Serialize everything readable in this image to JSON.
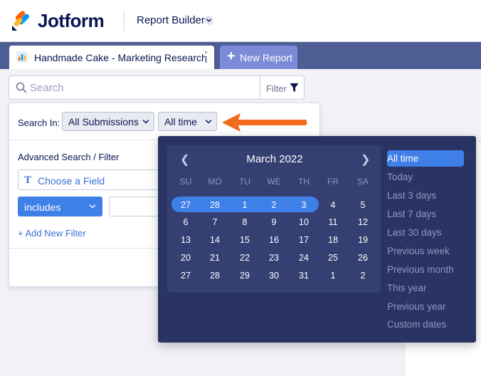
{
  "header": {
    "brand": "Jotform",
    "product": "Report Builder"
  },
  "tabs": {
    "active_title": "Handmade Cake - Marketing Research",
    "new_report": "New Report"
  },
  "search": {
    "placeholder": "Search",
    "filter_label": "Filter"
  },
  "filter_panel": {
    "search_in_label": "Search In:",
    "submissions_select": "All Submissions",
    "time_select": "All time",
    "advanced_label": "Advanced Search / Filter",
    "field_placeholder": "Choose a Field",
    "condition": "includes",
    "add_filter": "+ Add New Filter"
  },
  "calendar": {
    "month": "March 2022",
    "weekdays": [
      "SU",
      "MO",
      "TU",
      "WE",
      "TH",
      "FR",
      "SA"
    ],
    "weeks": [
      [
        "27",
        "28",
        "1",
        "2",
        "3",
        "4",
        "5"
      ],
      [
        "6",
        "7",
        "8",
        "9",
        "10",
        "11",
        "12"
      ],
      [
        "13",
        "14",
        "15",
        "16",
        "17",
        "18",
        "19"
      ],
      [
        "20",
        "21",
        "22",
        "23",
        "24",
        "25",
        "26"
      ],
      [
        "27",
        "28",
        "29",
        "30",
        "31",
        "1",
        "2"
      ]
    ],
    "presets": [
      "All time",
      "Today",
      "Last 3 days",
      "Last 7 days",
      "Last 30 days",
      "Previous week",
      "Previous month",
      "This year",
      "Previous year",
      "Custom dates"
    ],
    "active_preset": "All time"
  },
  "colors": {
    "brand_navy": "#0a1551",
    "tab_bar": "#4f5d95",
    "accent_blue": "#3f7fe8",
    "picker_bg": "#293464",
    "arrow_orange": "#f26a1b"
  }
}
